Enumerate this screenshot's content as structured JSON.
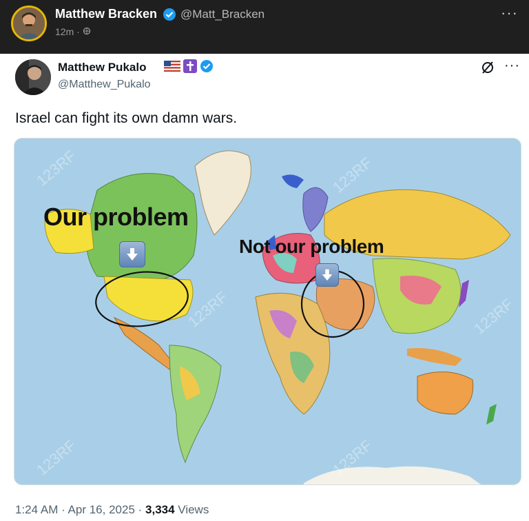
{
  "outer_post": {
    "author_name": "Matthew Bracken",
    "author_handle": "@Matt_Bracken",
    "timestamp": "12m",
    "separator": "·",
    "more_label": "···"
  },
  "quoted_post": {
    "author_name": "Matthew Pukalo",
    "author_handle": "@Matthew_Pukalo",
    "text": "Israel can fight its own damn wars.",
    "more_label": "···"
  },
  "media": {
    "label_our": "Our problem",
    "label_not": "Not our problem",
    "watermark": "123RF"
  },
  "footer": {
    "time": "1:24 AM",
    "dot1": " · ",
    "date": "Apr 16, 2025",
    "dot2": " · ",
    "views_count": "3,334",
    "views_label": " Views"
  },
  "colors": {
    "ocean": "#a9cfe8",
    "usa": "#f5e03a",
    "canada": "#7cc25b",
    "verified": "#1d9bf0",
    "circle": "#111111"
  },
  "icons": [
    "verified-badge-icon",
    "us-flag-icon",
    "cross-icon",
    "grok-icon",
    "more-icon",
    "down-arrow-icon",
    "globe-icon"
  ]
}
